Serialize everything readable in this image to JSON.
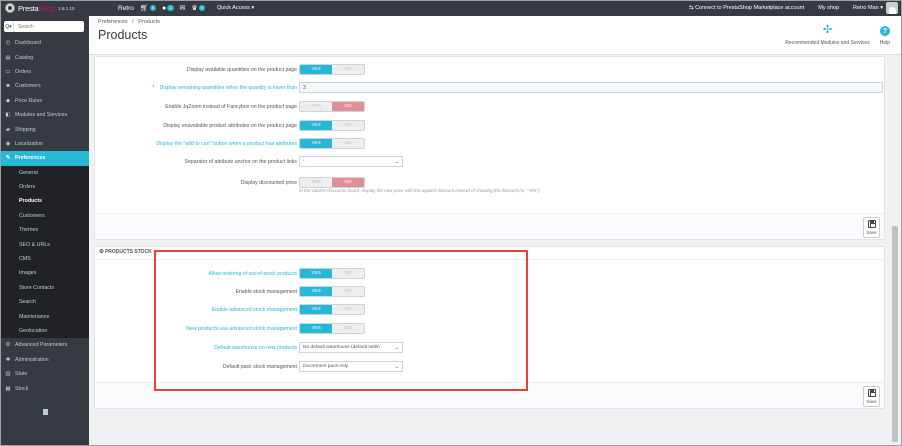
{
  "topbar": {
    "brand_prefix": "Presta",
    "brand_suffix": "Shop",
    "version": "1.6.1.15",
    "shop_name": "Retro",
    "orders_count": "5",
    "customers_count": "1",
    "messages_count": "4",
    "quick_access": "Quick Access ▾",
    "connect_label": "Connect to PrestaShop Marketplace account",
    "my_shop": "My shop",
    "user": "Retro Man ▾"
  },
  "sidebar": {
    "search_button": "Q▾",
    "search_placeholder": "Search",
    "items": [
      {
        "label": "Dashboard",
        "icon": "◴"
      },
      {
        "label": "Catalog",
        "icon": "▤"
      },
      {
        "label": "Orders",
        "icon": "▭"
      },
      {
        "label": "Customers",
        "icon": "☻"
      },
      {
        "label": "Price Rules",
        "icon": "◆"
      },
      {
        "label": "Modules and Services",
        "icon": "◧"
      },
      {
        "label": "Shipping",
        "icon": "▰"
      },
      {
        "label": "Localization",
        "icon": "◉"
      },
      {
        "label": "Preferences",
        "icon": "✎"
      }
    ],
    "sub_items": [
      "General",
      "Orders",
      "Products",
      "Customers",
      "Themes",
      "SEO & URLs",
      "CMS",
      "Images",
      "Store Contacts",
      "Search",
      "Maintenance",
      "Geolocation"
    ],
    "bottom_items": [
      {
        "label": "Advanced Parameters",
        "icon": "⚙"
      },
      {
        "label": "Administration",
        "icon": "✱"
      },
      {
        "label": "Stats",
        "icon": "▥"
      },
      {
        "label": "Stock",
        "icon": "▦"
      }
    ]
  },
  "header": {
    "crumb_parent": "Preferences",
    "crumb_sep": "/",
    "crumb_current": "Products",
    "title": "Products",
    "recommended": "Recommended Modules and Services",
    "help": "Help"
  },
  "panel1": {
    "rows": [
      {
        "label": "Display available quantities on the product page",
        "yes": "YES",
        "no": "NO"
      },
      {
        "label": "Display remaining quantities when the quantity is lower than",
        "required": "*",
        "value": "3"
      },
      {
        "label": "Enable JqZoom instead of Fancybox on the product page",
        "yes": "YES",
        "no": "NO"
      },
      {
        "label": "Display unavailable product attributes on the product page",
        "yes": "YES",
        "no": "NO"
      },
      {
        "label": "Display the \"add to cart\" button when a product has attributes",
        "yes": "YES",
        "no": "NO"
      },
      {
        "label": "Separator of attribute anchor on the product links",
        "value": "-"
      },
      {
        "label": "Display discounted price",
        "yes": "YES",
        "no": "NO"
      }
    ],
    "help_text": "In the volume discounts board, display the new price with the applied discount instead of showing the discount (ie. \"-5%\").",
    "save": "Save"
  },
  "panel2": {
    "heading": "PRODUCTS STOCK",
    "rows": [
      {
        "label": "Allow ordering of out-of-stock products",
        "yes": "YES",
        "no": "NO"
      },
      {
        "label": "Enable stock management",
        "yes": "YES",
        "no": "NO"
      },
      {
        "label": "Enable advanced stock management",
        "yes": "YES",
        "no": "NO"
      },
      {
        "label": "New products use advanced stock management",
        "yes": "YES",
        "no": "NO"
      },
      {
        "label": "Default warehouse on new products",
        "value": "No default warehouse (default settin"
      },
      {
        "label": "Default pack stock management",
        "value": "Decrement pack only."
      }
    ],
    "save": "Save"
  },
  "colors": {
    "accent": "#25b9d7",
    "danger": "#e08f95",
    "highlight": "#e8423d",
    "sidebar": "#363a41"
  }
}
